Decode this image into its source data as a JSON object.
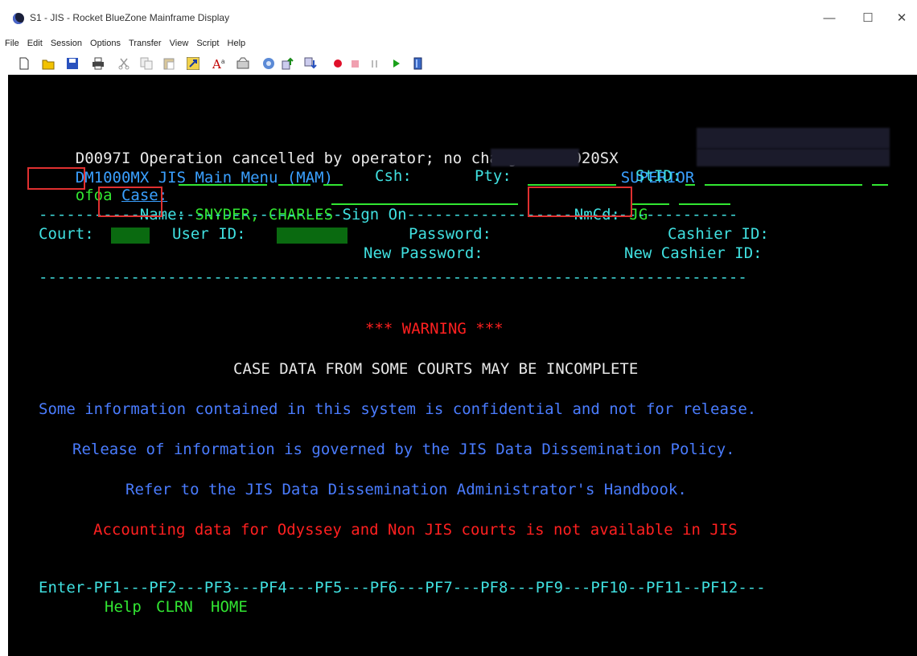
{
  "window": {
    "title": "S1 - JIS - Rocket BlueZone Mainframe Display",
    "minimize": "—",
    "maximize": "☐",
    "close": "✕"
  },
  "menu": [
    "File",
    "Edit",
    "Session",
    "Options",
    "Transfer",
    "View",
    "Script",
    "Help"
  ],
  "toolbar_icons": [
    "new-icon",
    "open-icon",
    "save-icon",
    "print-icon",
    "cut-icon",
    "copy-icon",
    "paste-icon",
    "macro-icon",
    "font-icon",
    "clear-icon",
    "refresh-icon",
    "send-icon",
    "receive-icon",
    "record-icon",
    "stop-icon",
    "pause-icon",
    "play-icon",
    "book-icon"
  ],
  "terminal": {
    "status_msg": "D0097I Operation cancelled by operator; no change",
    "screen_id": "DG0020SX",
    "menu_title": "DM1000MX JIS Main Menu (MAM)",
    "court_level": "SUPERIOR",
    "command": "ofoa",
    "case_label": "Case:",
    "csh_label": "Csh:",
    "pty_label": "Pty:",
    "stid_label": "StID:",
    "name_label": "Name:",
    "name_value": "SNYDER, CHARLES",
    "nmcd_label": "NmCd:",
    "nmcd_value": "JG",
    "signon_line": "---------------------------------Sign On------------------------------------",
    "court_label": "Court:",
    "userid_label": "User ID:",
    "password_label": "Password:",
    "cashier_label": "Cashier ID:",
    "new_password_label": "New Password:",
    "new_cashier_label": "New Cashier ID:",
    "divider": "-----------------------------------------------------------------------------",
    "warning": "*** WARNING ***",
    "case_notice": "CASE DATA FROM SOME COURTS MAY BE INCOMPLETE",
    "info1": "Some information contained in this system is confidential and not for release.",
    "info2": "Release of information is governed by the JIS Data Dissemination Policy.",
    "info3": "Refer to the JIS Data Dissemination Administrator's Handbook.",
    "accounting": "Accounting data for Odyssey and Non JIS courts is not available in JIS",
    "pf_line": "Enter-PF1---PF2---PF3---PF4---PF5---PF6---PF7---PF8---PF9---PF10--PF11--PF12---",
    "pf1": "Help",
    "pf2": "CLRN",
    "pf3": "HOME"
  },
  "colors": {
    "highlight_box": "#e03030",
    "terminal_bg": "#000000",
    "green": "#32e632",
    "cyan": "#40e0e0"
  }
}
